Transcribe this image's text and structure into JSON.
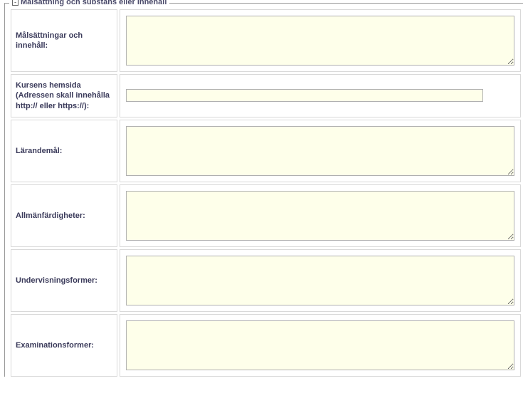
{
  "section": {
    "title": "Målsättning och substans eller innehåll",
    "collapse_symbol": "-"
  },
  "fields": {
    "goals": {
      "label": "Målsättningar och innehåll:",
      "value": ""
    },
    "homepage": {
      "label": "Kursens hemsida (Adressen skall innehålla http:// eller https://):",
      "value": ""
    },
    "learning": {
      "label": "Lärandemål:",
      "value": ""
    },
    "general_skills": {
      "label": "Allmänfärdigheter:",
      "value": ""
    },
    "teaching_forms": {
      "label": "Undervisningsformer:",
      "value": ""
    },
    "exam_forms": {
      "label": "Examinationsformer:",
      "value": ""
    }
  }
}
